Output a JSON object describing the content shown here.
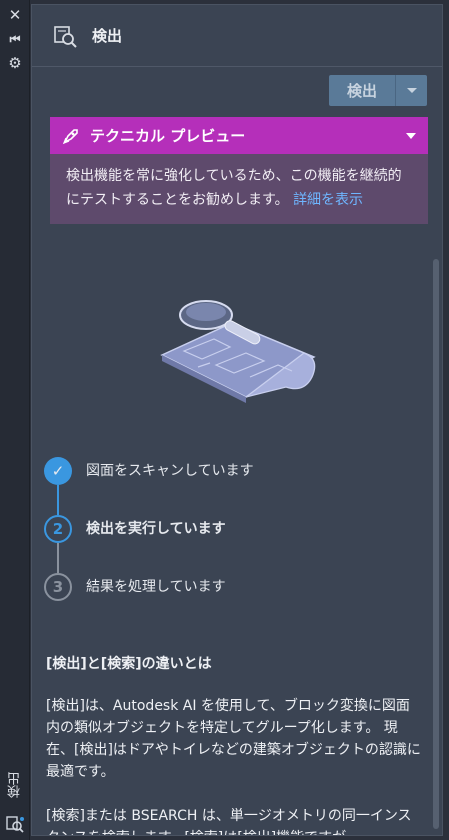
{
  "rail": {
    "close_glyph": "✕",
    "collapse_glyph": "⏮",
    "settings_glyph": "⚙",
    "vertical_label": "検出"
  },
  "header": {
    "title": "検出",
    "icon": "detect-magnifier-icon"
  },
  "toolbar": {
    "detect_label": "検出",
    "dropdown_icon": "chevron-down-icon"
  },
  "preview": {
    "title": "テクニカル プレビュー",
    "body": "検出機能を常に強化しているため、この機能を継続的にテストすることをお勧めします。",
    "link": "詳細を表示",
    "color": "#b52fba"
  },
  "steps": [
    {
      "label": "図面をスキャンしています",
      "marker": "✓",
      "state": "done"
    },
    {
      "label": "検出を実行しています",
      "marker": "2",
      "state": "active"
    },
    {
      "label": "結果を処理しています",
      "marker": "3",
      "state": "pending"
    }
  ],
  "article": {
    "heading": "[検出]と[検索]の違いとは",
    "para1": "[検出]は、Autodesk AI を使用して、ブロック変換に図面内の類似オブジェクトを特定してグループ化します。 現在、[検出]はドアやトイレなどの建築オブジェクトの認識に最適です。",
    "para2": "[検索]または BSEARCH は、単一ジオメトリの同一インスタンスを検索します。[検索]は[検出]機能ですが"
  },
  "colors": {
    "accent": "#3a97e0",
    "panel": "#3b4453"
  }
}
